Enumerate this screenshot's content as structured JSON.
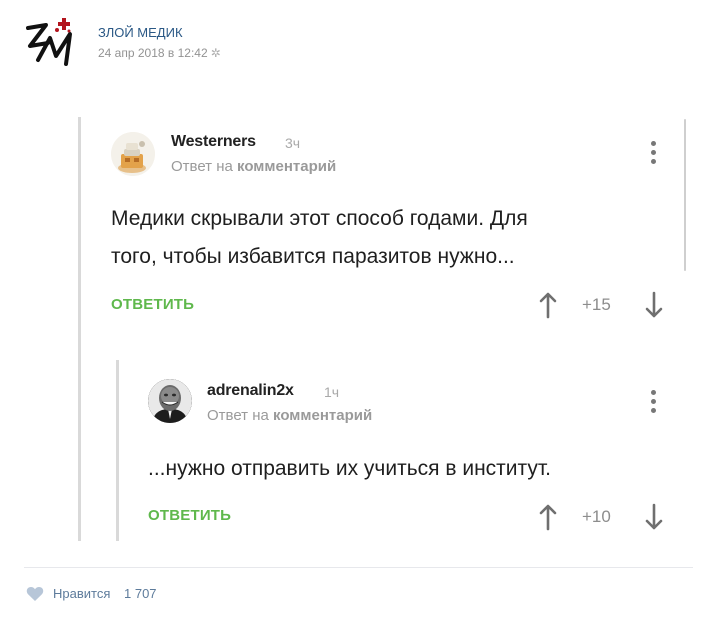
{
  "post": {
    "author": "ЗЛОЙ МЕДИК",
    "date": "24 апр 2018 в 12:42",
    "logo_icon": "zm-logo-icon",
    "settings_icon": "gear-icon"
  },
  "comments": [
    {
      "username": "Westerners",
      "time": "3ч",
      "reply_to_prefix": "Ответ на",
      "reply_to_target": "комментарий",
      "text_line1": "Медики скрывали этот способ годами. Для",
      "text_line2": "того, чтобы избавится паразитов нужно...",
      "reply_label": "ОТВЕТИТЬ",
      "score": "+15"
    },
    {
      "username": "adrenalin2x",
      "time": "1ч",
      "reply_to_prefix": "Ответ на",
      "reply_to_target": "комментарий",
      "text_line1": "...нужно отправить их учиться в институт.",
      "reply_label": "ОТВЕТИТЬ",
      "score": "+10"
    }
  ],
  "footer": {
    "likes_label": "Нравится",
    "likes_count": "1 707"
  },
  "colors": {
    "link": "#2a5885",
    "reply_green": "#5fb84c",
    "muted": "#939393"
  }
}
